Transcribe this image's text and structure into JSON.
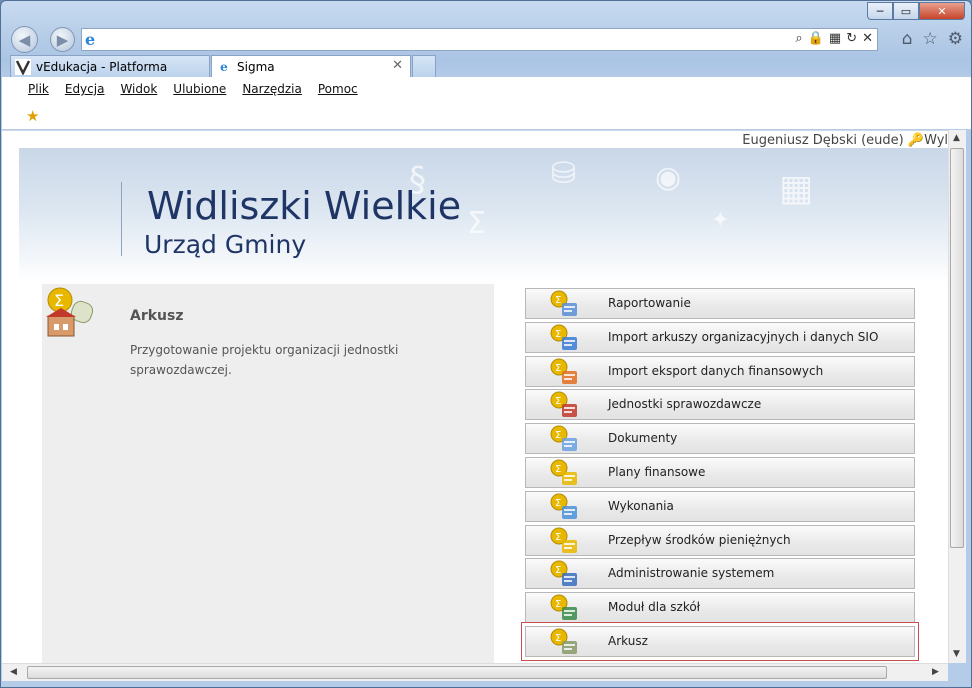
{
  "window": {
    "min": "─",
    "max": "▭",
    "close": "✕"
  },
  "address": {
    "value": ""
  },
  "tabs": [
    {
      "label": "vEdukacja - Platforma",
      "icon": "v-logo-icon"
    },
    {
      "label": "Sigma",
      "icon": "ie-page-icon",
      "close": "✕"
    }
  ],
  "menu": [
    "Plik",
    "Edycja",
    "Widok",
    "Ulubione",
    "Narzędzia",
    "Pomoc"
  ],
  "user": {
    "name": "Eugeniusz Dębski (eude)",
    "logout": "Wyl"
  },
  "banner": {
    "title": "Widliszki Wielkie",
    "subtitle": "Urząd Gminy"
  },
  "panel": {
    "title": "Arkusz",
    "description": "Przygotowanie projektu organizacji jednostki sprawozdawczej."
  },
  "modules": [
    {
      "label": "Raportowanie",
      "icon": "report-icon"
    },
    {
      "label": "Import arkuszy organizacyjnych i danych SIO",
      "icon": "import-icon"
    },
    {
      "label": "Import eksport danych finansowych",
      "icon": "import-export-icon"
    },
    {
      "label": "Jednostki sprawozdawcze",
      "icon": "building-icon"
    },
    {
      "label": "Dokumenty",
      "icon": "documents-icon"
    },
    {
      "label": "Plany finansowe",
      "icon": "coins-icon"
    },
    {
      "label": "Wykonania",
      "icon": "execution-icon"
    },
    {
      "label": "Przepływ środków pieniężnych",
      "icon": "cashflow-icon"
    },
    {
      "label": "Administrowanie systemem",
      "icon": "admin-gears-icon"
    },
    {
      "label": "Moduł dla szkół",
      "icon": "school-board-icon"
    },
    {
      "label": "Arkusz",
      "icon": "worksheet-icon",
      "selected": true
    }
  ],
  "colors": {
    "title": "#1f3566",
    "sigma": "#e8b800",
    "selected_outline": "#c55050"
  }
}
